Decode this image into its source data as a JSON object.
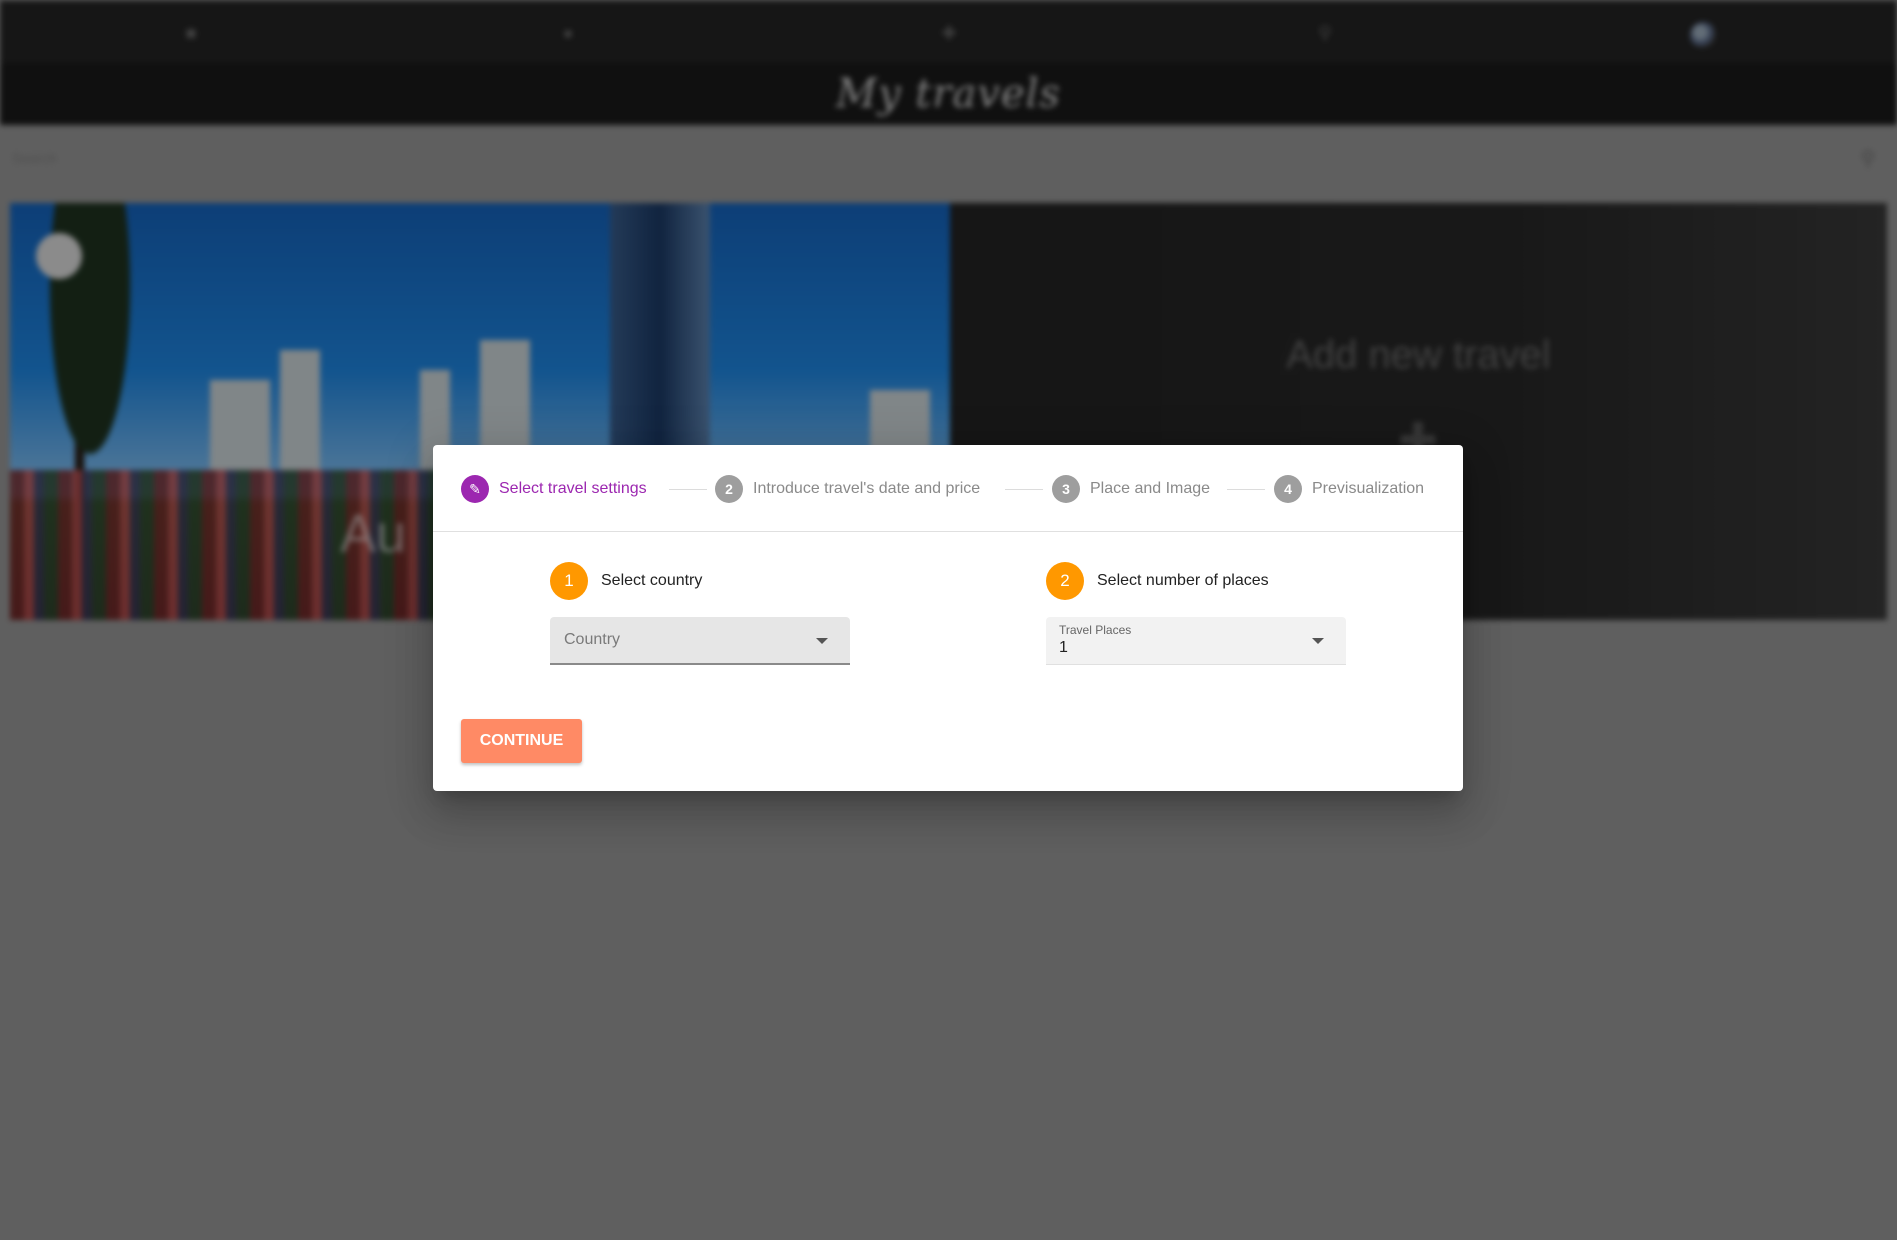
{
  "app": {
    "title": "My travels",
    "nav_icons": [
      "home-icon",
      "chat-icon",
      "add-icon",
      "search-icon",
      "avatar"
    ],
    "search": {
      "placeholder": "Search"
    },
    "cards": {
      "add_travel_title": "Add new travel",
      "add_travel_icon": "plus-icon",
      "travel_card_text": "Au"
    }
  },
  "dialog": {
    "steps": [
      {
        "index": "✎",
        "label": "Select travel settings",
        "state": "active"
      },
      {
        "index": "2",
        "label": "Introduce travel's date and price",
        "state": "inactive"
      },
      {
        "index": "3",
        "label": "Place and Image",
        "state": "inactive"
      },
      {
        "index": "4",
        "label": "Previsualization",
        "state": "inactive"
      }
    ],
    "country_step": {
      "number": "1",
      "label": "Select country",
      "select_placeholder": "Country"
    },
    "places_step": {
      "number": "2",
      "label": "Select number of places",
      "select_label": "Travel Places",
      "select_value": "1"
    },
    "continue_label": "CONTINUE"
  },
  "colors": {
    "accent_purple": "#9c27b0",
    "orange": "#ff9800",
    "continue_button": "#ff8a65",
    "step_inactive": "#9e9e9e"
  }
}
